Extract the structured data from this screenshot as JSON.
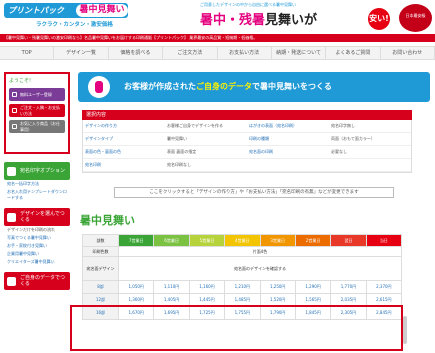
{
  "header": {
    "logo": "プリントパック",
    "logo_badge": "暑中見舞い",
    "tagline": "ラクラク・カンタン・激安価格",
    "promo_top": "ご用意したデザインの中から自由に選べる暑中見舞い",
    "promo_main_pink": "暑中・残暑",
    "promo_main_black": "見舞いが",
    "yasui": "安い!",
    "seal": "日本最安級"
  },
  "notice": "【暑中見舞い・残暑見舞いの激安印刷なら】名品暑中見舞いをお届けする印刷通販【プリントパック】 業界最安の高品質・短納期・低価格。",
  "nav": [
    "TOP",
    "デザイン一覧",
    "価格を調べる",
    "ご注文方法",
    "お支払い方法",
    "納期・発送について",
    "よくあるご質問",
    "お問い合わせ"
  ],
  "sidebar": {
    "welcome_title": "ようこそ!",
    "buttons": [
      {
        "label": "無料ユーザー登録",
        "color": "purple"
      },
      {
        "label": "ご注文・入稿・お支払い方法",
        "color": "red"
      },
      {
        "label": "お気に入り商品（お仕事用）",
        "color": "gray"
      }
    ],
    "options_title": "宛名印字オプション",
    "options_links": [
      "宛名一括印字方法",
      "お名入れ用テンプレートダウンロードする"
    ],
    "design_title": "デザインを選んでつくる",
    "design_text": "デザインだけを印刷の流れ",
    "design_links": [
      "写真でつくる暑中見舞い",
      "お手・家紋付き見舞い",
      "企業用暑中見舞い",
      "クリエイターズ暑中見舞い"
    ],
    "own_title": "ご自身のデータでつくる"
  },
  "main": {
    "banner_pre": "お客様が作成された",
    "banner_hl": "ご自身のデータ",
    "banner_post": "で暑中見舞いをつくる",
    "steps_title": "選択内容",
    "steps": [
      {
        "k": "デザインの作り方",
        "v": "お客様ご自身でデザインを作る"
      },
      {
        "k": "はがきの表面（宛名印刷）",
        "v": "宛名印字無し"
      },
      {
        "k": "デザインタイプ",
        "v": "暑中見舞い"
      },
      {
        "k": "印刷の種類",
        "v": "両面（おもて面カラー）"
      },
      {
        "k": "表面の色・裏面の色",
        "v": "表面 裏面の指定"
      },
      {
        "k": "宛名面の印刷",
        "v": "必要なし"
      },
      {
        "k": "宛名印刷",
        "v": "宛名印刷なし"
      },
      {
        "k": "",
        "v": ""
      }
    ],
    "cta": "ここをクリックすると「デザインの作り方」や「お支払い方法」「宛名印刷の有無」などが変更できます",
    "section_title": "暑中見舞い",
    "table": {
      "head_label": "部数",
      "days": [
        {
          "label": "7営業日",
          "color": "#3aa536"
        },
        {
          "label": "6営業日",
          "color": "#7cc242"
        },
        {
          "label": "5営業日",
          "color": "#b7d33b"
        },
        {
          "label": "4営業日",
          "color": "#f2c500"
        },
        {
          "label": "3営業日",
          "color": "#f29600"
        },
        {
          "label": "2営業日",
          "color": "#ec6c00"
        },
        {
          "label": "翌日",
          "color": "#e83828"
        },
        {
          "label": "当日",
          "color": "#e60012"
        }
      ],
      "row_print_label": "印刷色数",
      "row_print_value": "片面4色",
      "row_design_label": "宛名面デザイン",
      "row_design_value": "宛名面のデザインを確認する",
      "rows": [
        {
          "qty": "8部",
          "prices": [
            "1,050円",
            "1,110円",
            "1,160円",
            "1,210円",
            "1,250円",
            "1,290円",
            "1,770円",
            "2,370円"
          ]
        },
        {
          "qty": "12部",
          "prices": [
            "1,360円",
            "1,405円",
            "1,445円",
            "1,485円",
            "1,520円",
            "1,565円",
            "2,035円",
            "2,615円"
          ]
        },
        {
          "qty": "16部",
          "prices": [
            "1,670円",
            "1,695円",
            "1,725円",
            "1,755円",
            "1,790円",
            "1,845円",
            "2,305円",
            "2,845円"
          ]
        }
      ]
    }
  }
}
